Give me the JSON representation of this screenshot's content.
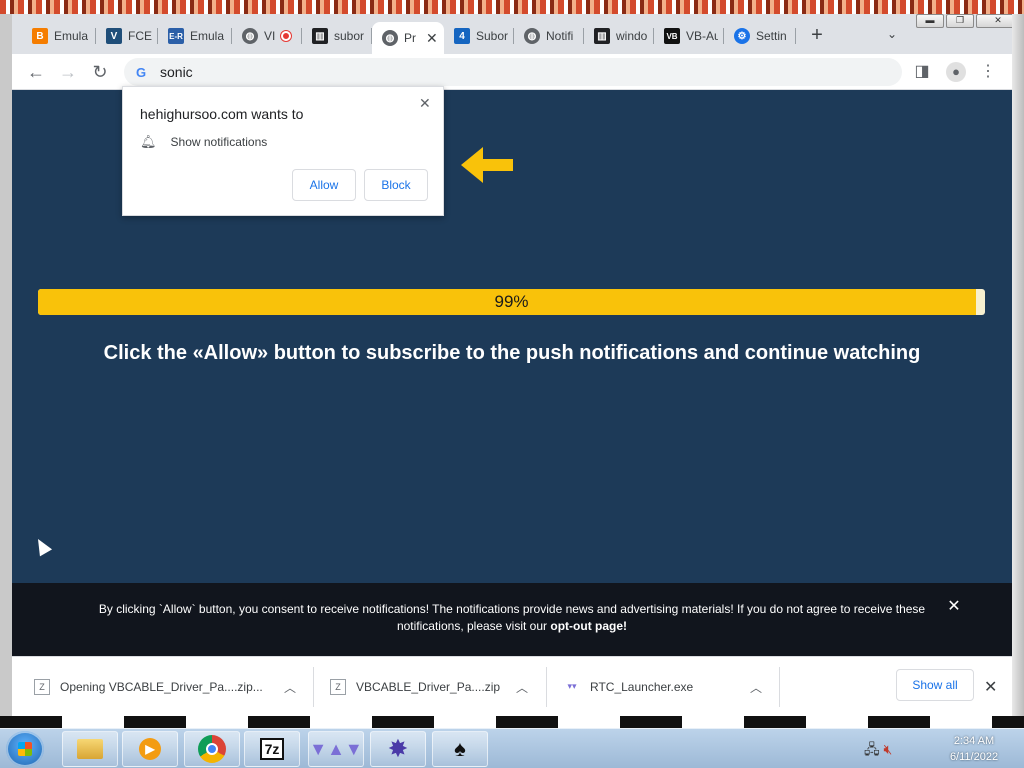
{
  "browser": {
    "tabs": [
      {
        "label": "Emula",
        "icon": "blogger-icon",
        "color": "#f57d00"
      },
      {
        "label": "FCEUX",
        "icon": "fceux-icon",
        "color": "#1f4e79"
      },
      {
        "label": "Emula",
        "icon": "emu-icon",
        "color": "#2b5fa8"
      },
      {
        "label": "VI",
        "icon": "globe-icon",
        "color": "#5f6368"
      },
      {
        "label": "subor",
        "icon": "archive-icon",
        "color": "#202124"
      },
      {
        "label": "Pr",
        "icon": "globe-icon",
        "color": "#5f6368",
        "active": true
      },
      {
        "label": "Subor",
        "icon": "four-icon",
        "color": "#1565c0"
      },
      {
        "label": "Notifi",
        "icon": "globe-icon",
        "color": "#5f6368"
      },
      {
        "label": "windo",
        "icon": "archive-icon",
        "color": "#202124"
      },
      {
        "label": "VB-Au",
        "icon": "vb-icon",
        "color": "#111111"
      },
      {
        "label": "Settin",
        "icon": "gear-icon",
        "color": "#1a73e8"
      }
    ],
    "address": "sonic"
  },
  "popup": {
    "title": "hehighursoo.com wants to",
    "permission": "Show notifications",
    "allow_label": "Allow",
    "block_label": "Block"
  },
  "page": {
    "progress_label": "99%",
    "progress_value": 0.99,
    "headline_before": "Click the ",
    "headline_bold": "«Allow»",
    "headline_after": " button to subscribe to the push notifications and continue watching",
    "consent_text": "By clicking `Allow` button, you consent to receive notifications! The notifications provide news and advertising materials! If you do not agree to receive these notifications, please visit our ",
    "consent_link": "opt-out page!"
  },
  "downloads": {
    "items": [
      {
        "label": "Opening VBCABLE_Driver_Pa....zip..."
      },
      {
        "label": "VBCABLE_Driver_Pa....zip"
      },
      {
        "label": "RTC_Launcher.exe"
      }
    ],
    "show_all": "Show all"
  },
  "taskbar": {
    "time": "2:34 AM",
    "date": "6/11/2022",
    "apps": [
      {
        "name": "file-explorer"
      },
      {
        "name": "media-player"
      },
      {
        "name": "chrome"
      },
      {
        "name": "7zip",
        "label": "7z"
      },
      {
        "name": "app-purple"
      },
      {
        "name": "app-cat"
      },
      {
        "name": "app-mask"
      }
    ]
  },
  "colors": {
    "page_bg": "#1d3a58",
    "progress_fill": "#f9c20a",
    "arrow": "#f9c20a",
    "accent_blue": "#1a73e8"
  }
}
